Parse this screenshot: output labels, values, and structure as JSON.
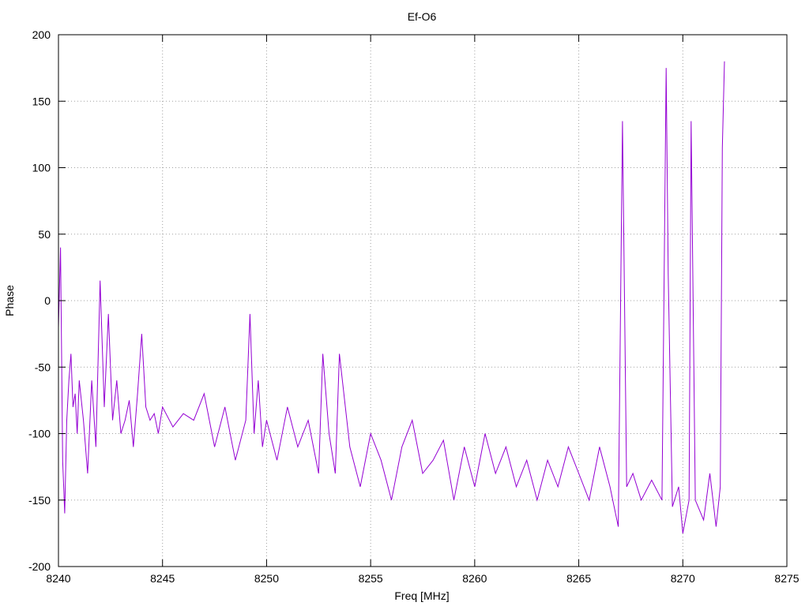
{
  "chart_data": {
    "type": "line",
    "title": "Ef-O6",
    "xlabel": "Freq [MHz]",
    "ylabel": "Phase",
    "xlim": [
      8240,
      8275
    ],
    "ylim": [
      -200,
      200
    ],
    "xticks": [
      8240,
      8245,
      8250,
      8255,
      8260,
      8265,
      8270,
      8275
    ],
    "yticks": [
      -200,
      -150,
      -100,
      -50,
      0,
      50,
      100,
      150,
      200
    ],
    "grid": true,
    "legend": "none",
    "line_color": "#9400d3",
    "series": [
      {
        "x": [
          8240.0,
          8240.1,
          8240.2,
          8240.3,
          8240.4,
          8240.5,
          8240.6,
          8240.7,
          8240.8,
          8240.9,
          8241.0,
          8241.2,
          8241.4,
          8241.6,
          8241.8,
          8242.0,
          8242.2,
          8242.4,
          8242.6,
          8242.8,
          8243.0,
          8243.2,
          8243.4,
          8243.6,
          8243.8,
          8244.0,
          8244.2,
          8244.4,
          8244.6,
          8244.8,
          8245.0,
          8245.5,
          8246.0,
          8246.5,
          8247.0,
          8247.5,
          8248.0,
          8248.5,
          8249.0,
          8249.2,
          8249.4,
          8249.6,
          8249.8,
          8250.0,
          8250.5,
          8251.0,
          8251.5,
          8252.0,
          8252.5,
          8252.7,
          8253.0,
          8253.3,
          8253.5,
          8254.0,
          8254.5,
          8255.0,
          8255.5,
          8256.0,
          8256.5,
          8257.0,
          8257.5,
          8258.0,
          8258.5,
          8259.0,
          8259.5,
          8260.0,
          8260.5,
          8261.0,
          8261.5,
          8262.0,
          8262.5,
          8263.0,
          8263.5,
          8264.0,
          8264.5,
          8265.0,
          8265.5,
          8266.0,
          8266.5,
          8266.9,
          8267.1,
          8267.3,
          8267.6,
          8268.0,
          8268.5,
          8269.0,
          8269.2,
          8269.3,
          8269.5,
          8269.8,
          8270.0,
          8270.3,
          8270.4,
          8270.6,
          8271.0,
          8271.3,
          8271.6,
          8271.8,
          8271.9,
          8272.0
        ],
        "y": [
          -20,
          40,
          -120,
          -160,
          -90,
          -60,
          -40,
          -80,
          -70,
          -100,
          -60,
          -90,
          -130,
          -60,
          -110,
          15,
          -80,
          -10,
          -90,
          -60,
          -100,
          -90,
          -75,
          -110,
          -70,
          -25,
          -80,
          -90,
          -85,
          -100,
          -80,
          -95,
          -85,
          -90,
          -70,
          -110,
          -80,
          -120,
          -90,
          -10,
          -100,
          -60,
          -110,
          -90,
          -120,
          -80,
          -110,
          -90,
          -130,
          -40,
          -100,
          -130,
          -40,
          -110,
          -140,
          -100,
          -120,
          -150,
          -110,
          -90,
          -130,
          -120,
          -105,
          -150,
          -110,
          -140,
          -100,
          -130,
          -110,
          -140,
          -120,
          -150,
          -120,
          -140,
          -110,
          -130,
          -150,
          -110,
          -140,
          -170,
          135,
          -140,
          -130,
          -150,
          -135,
          -150,
          175,
          20,
          -155,
          -140,
          -175,
          -150,
          135,
          -150,
          -165,
          -130,
          -170,
          -140,
          115,
          180
        ]
      }
    ]
  }
}
